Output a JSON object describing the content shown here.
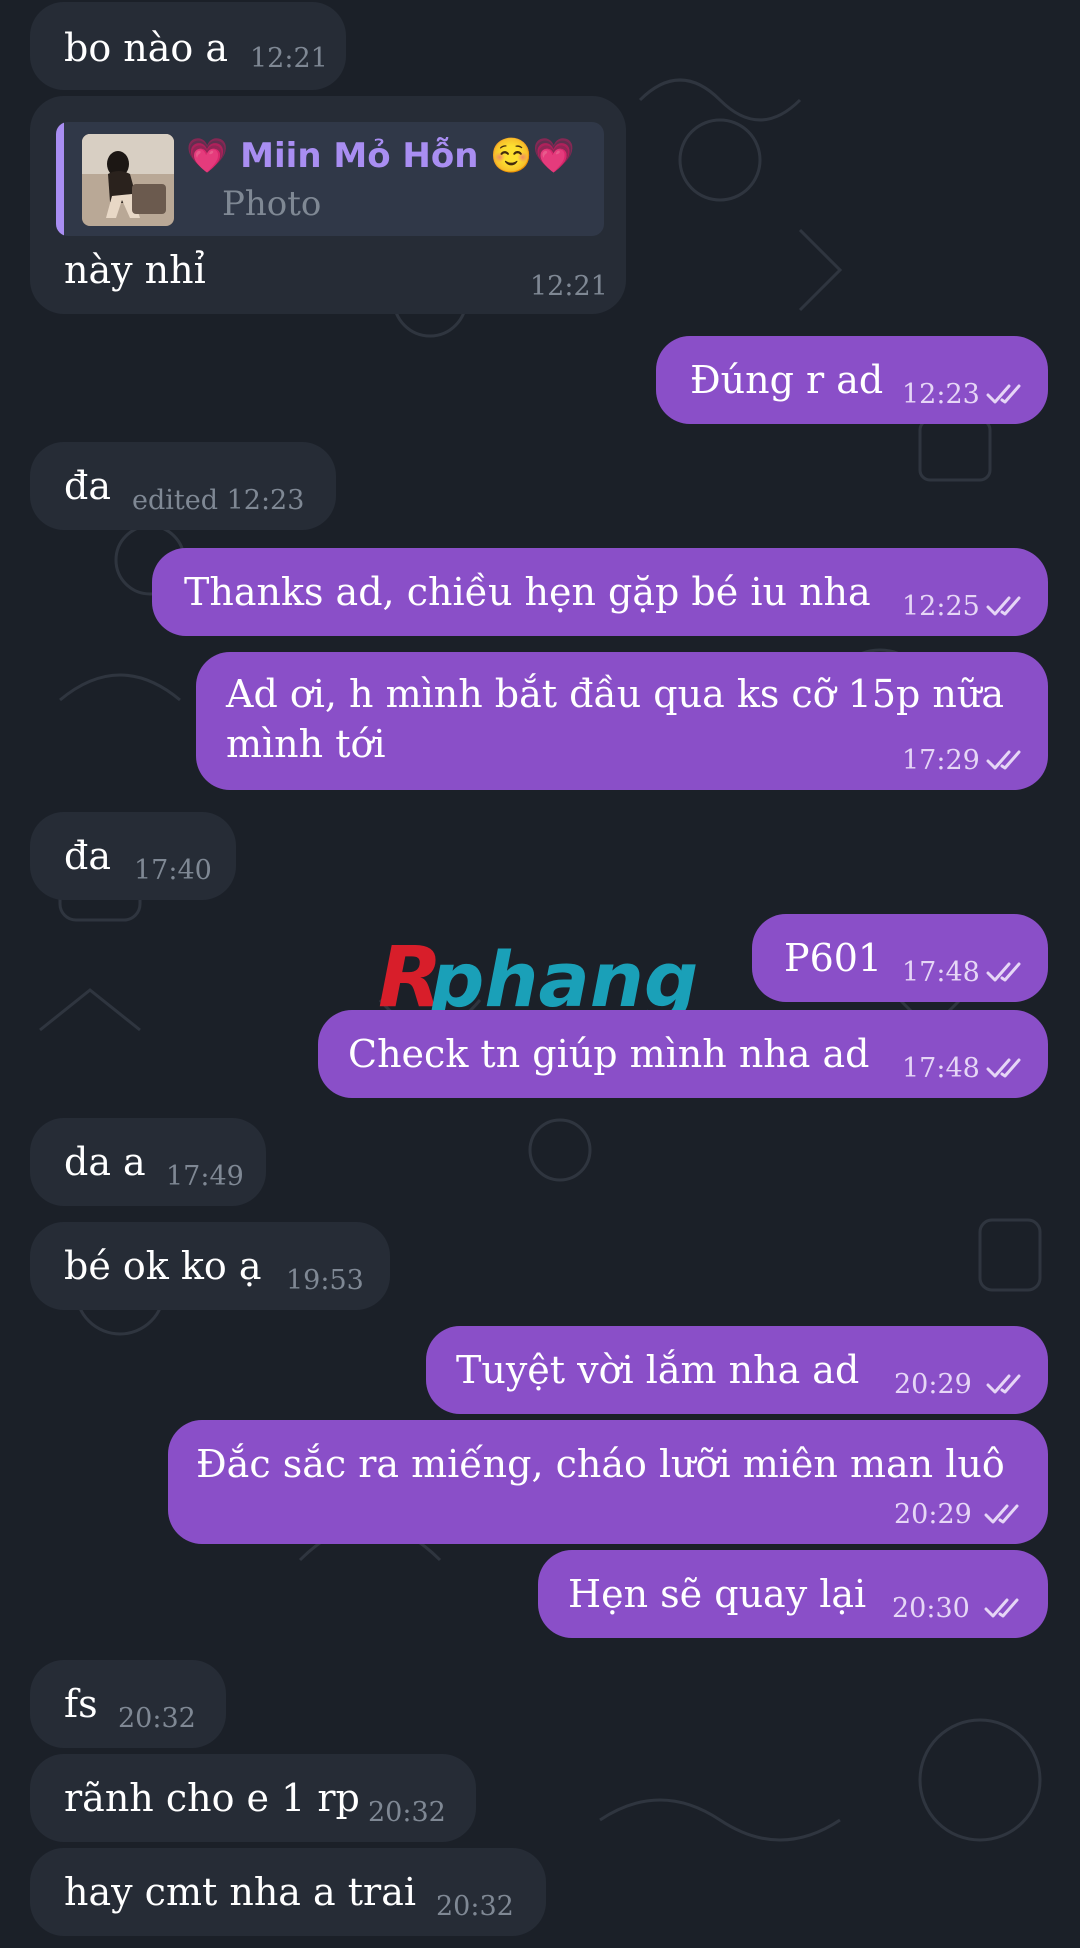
{
  "watermark": {
    "text_a": "R",
    "text_b": "phang"
  },
  "reply": {
    "author": "💗 Miin Mỏ Hỗn ☺️💗",
    "type": "Photo"
  },
  "messages": [
    {
      "dir": "in",
      "text": "bo nào a",
      "time": "12:21"
    },
    {
      "dir": "in",
      "text": "này nhỉ",
      "time": "12:21",
      "has_reply": true
    },
    {
      "dir": "out",
      "text": "Đúng r ad",
      "time": "12:23",
      "status": "read"
    },
    {
      "dir": "in",
      "text": "đa",
      "time": "edited 12:23"
    },
    {
      "dir": "out",
      "text": "Thanks ad, chiều hẹn gặp bé iu nha",
      "time": "12:25",
      "status": "read"
    },
    {
      "dir": "out",
      "text_line1": "Ad ơi, h mình bắt đầu qua ks cỡ 15p nữa",
      "text_line2": "mình tới",
      "time": "17:29",
      "status": "read"
    },
    {
      "dir": "in",
      "text": "đa",
      "time": "17:40"
    },
    {
      "dir": "out",
      "text": "P601",
      "time": "17:48",
      "status": "read"
    },
    {
      "dir": "out",
      "text": "Check tn giúp mình nha ad",
      "time": "17:48",
      "status": "read"
    },
    {
      "dir": "in",
      "text": "da a",
      "time": "17:49"
    },
    {
      "dir": "in",
      "text": "bé ok ko ạ",
      "time": "19:53"
    },
    {
      "dir": "out",
      "text": "Tuyệt vời lắm nha ad",
      "time": "20:29",
      "status": "read"
    },
    {
      "dir": "out",
      "text": "Đắc sắc ra miếng, cháo lưỡi miên man luô",
      "time": "20:29",
      "status": "read"
    },
    {
      "dir": "out",
      "text": "Hẹn sẽ quay lại",
      "time": "20:30",
      "status": "read"
    },
    {
      "dir": "in",
      "text": "fs",
      "time": "20:32"
    },
    {
      "dir": "in",
      "text": "rãnh cho e 1 rp",
      "time": "20:32"
    },
    {
      "dir": "in",
      "text": "hay cmt nha a trai",
      "time": "20:32"
    }
  ],
  "colors": {
    "background": "#1b2028",
    "incoming_bubble": "#262c36",
    "outgoing_bubble": "#8a4fc8",
    "reply_accent": "#a98ef2",
    "watermark_red": "#d81e2a",
    "watermark_teal": "#1aa0b8"
  }
}
